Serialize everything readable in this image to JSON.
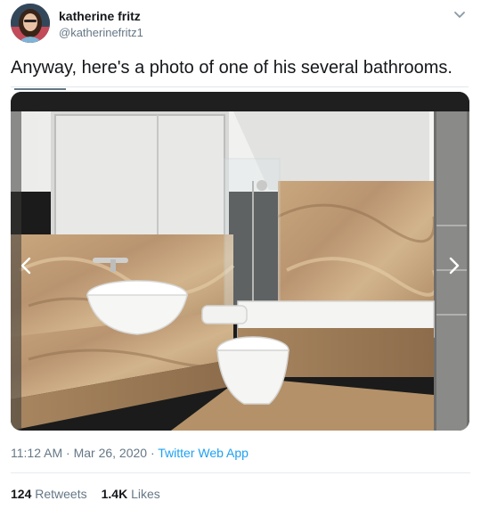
{
  "author": {
    "name": "katherine fritz",
    "handle": "@katherinefritz1"
  },
  "tweet": {
    "text": "Anyway, here's a photo of one of his several bathrooms."
  },
  "meta": {
    "time": "11:12 AM",
    "separator1": " · ",
    "date": "Mar 26, 2020",
    "separator2": " · ",
    "app": "Twitter Web App"
  },
  "stats": {
    "retweets_count": "124",
    "retweets_label": "Retweets",
    "likes_count": "1.4K",
    "likes_label": "Likes"
  },
  "icons": {
    "caret": "chevron-down-icon",
    "prev": "chevron-left-icon",
    "next": "chevron-right-icon"
  },
  "colors": {
    "link_blue": "#1da1f2",
    "secondary_text": "#657786",
    "primary_text": "#14171a"
  }
}
